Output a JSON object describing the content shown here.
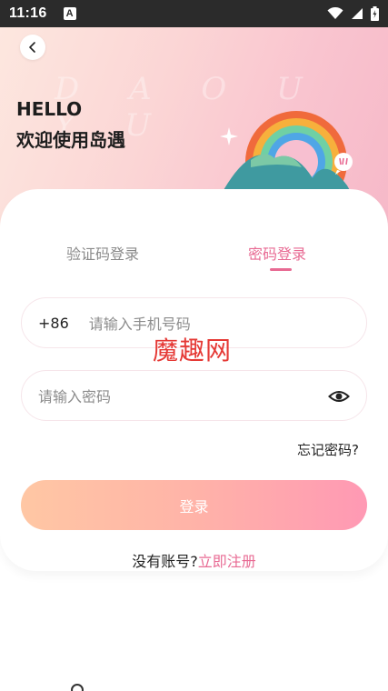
{
  "status_bar": {
    "time": "11:16",
    "notification_letter": "A"
  },
  "header": {
    "hello": "HELLO",
    "welcome": "欢迎使用岛遇",
    "watermark": "D A O U Y U"
  },
  "tabs": [
    {
      "label": "验证码登录",
      "active": false
    },
    {
      "label": "密码登录",
      "active": true
    }
  ],
  "form": {
    "country_code": "+86",
    "phone_placeholder": "请输入手机号码",
    "password_placeholder": "请输入密码",
    "forgot_password": "忘记密码?",
    "login_button": "登录"
  },
  "register": {
    "prompt": "没有账号?",
    "link": "立即注册"
  },
  "overlay_watermark": "魔趣网",
  "colors": {
    "accent": "#e86a93",
    "button_start": "#ffc7a4",
    "button_end": "#ff99b4",
    "watermark_red": "#e53935"
  }
}
